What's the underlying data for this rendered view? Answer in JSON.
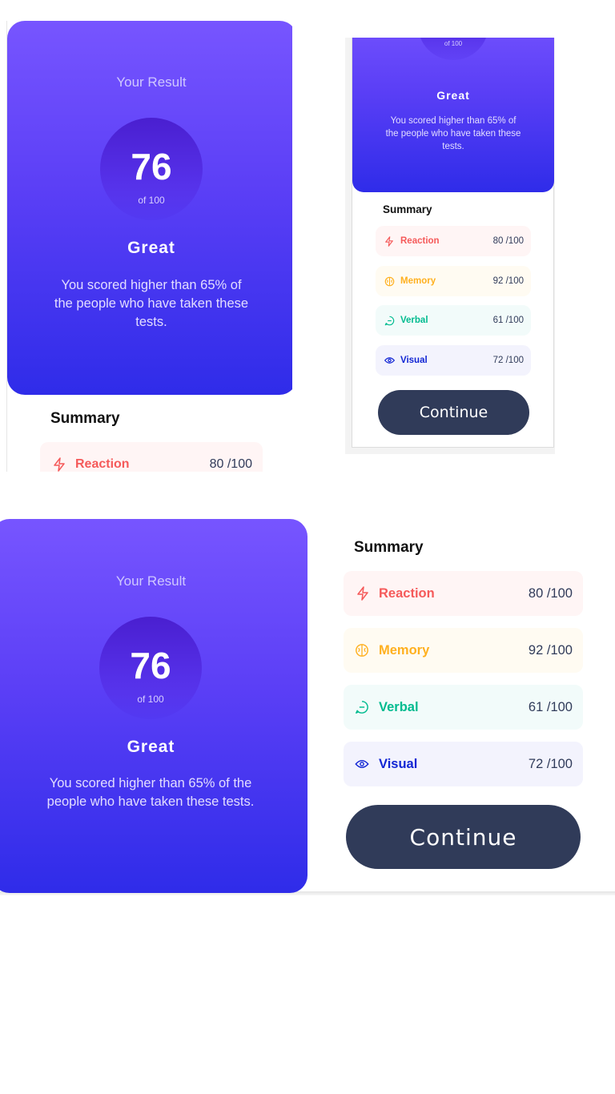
{
  "result": {
    "heading": "Your Result",
    "score": "76",
    "out_of": "of 100",
    "rating": "Great",
    "desc": "You scored higher than 65% of the people who have taken these tests."
  },
  "summary": {
    "title": "Summary",
    "items": [
      {
        "label": "Reaction",
        "score": "80",
        "total": "/100",
        "icon": "lightning-icon",
        "color": "#f55a5a",
        "bg": "#fff5f5"
      },
      {
        "label": "Memory",
        "score": "92",
        "total": "/100",
        "icon": "brain-icon",
        "color": "#ffb01f",
        "bg": "#fffbf2"
      },
      {
        "label": "Verbal",
        "score": "61",
        "total": "/100",
        "icon": "chat-icon",
        "color": "#00bb8f",
        "bg": "#f2fbfa"
      },
      {
        "label": "Visual",
        "score": "72",
        "total": "/100",
        "icon": "eye-icon",
        "color": "#1125d4",
        "bg": "#f3f3fd"
      }
    ],
    "button_label": "Continue"
  },
  "colors": {
    "gradient_top": "#7755ff",
    "gradient_bottom": "#2f2ce9",
    "button": "#303b59"
  }
}
